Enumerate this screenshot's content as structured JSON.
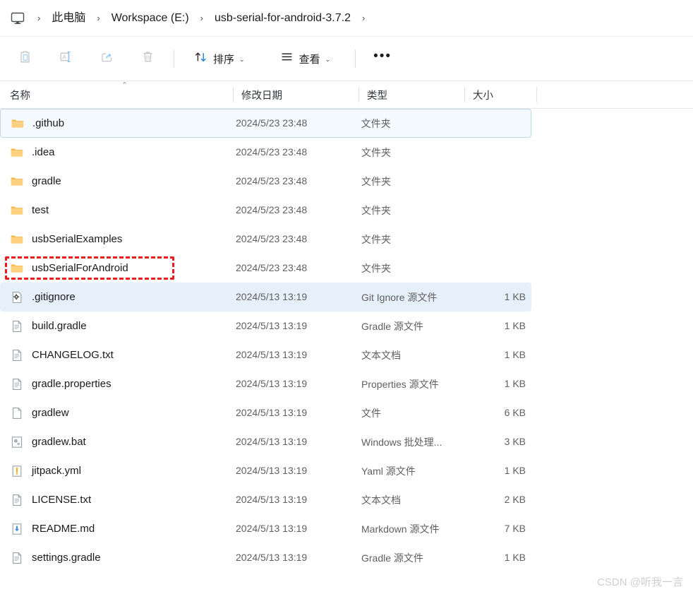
{
  "window": {
    "app": "File Explorer",
    "breadcrumb": {
      "home_icon": "monitor-icon",
      "items": [
        "此电脑",
        "Workspace (E:)",
        "usb-serial-for-android-3.7.2"
      ],
      "separator": "›",
      "trailing_separator": "›"
    }
  },
  "toolbar": {
    "icon_buttons": [
      {
        "name": "paste-button",
        "icon": "clipboard-paste-icon"
      },
      {
        "name": "rename-button",
        "icon": "rename-icon"
      },
      {
        "name": "share-button",
        "icon": "share-icon"
      },
      {
        "name": "delete-button",
        "icon": "trash-icon"
      }
    ],
    "sort_label": "排序",
    "sort_icon": "sort-arrows-icon",
    "view_label": "查看",
    "view_icon": "view-list-icon",
    "more_label": "•••",
    "caret": "⌄"
  },
  "columns": {
    "name": "名称",
    "date": "修改日期",
    "type": "类型",
    "size": "大小",
    "sort_indicator": "⌃"
  },
  "rows": [
    {
      "name": ".github",
      "date": "2024/5/23 23:48",
      "type": "文件夹",
      "size": "",
      "icon": "folder-icon",
      "state": "hovered"
    },
    {
      "name": ".idea",
      "date": "2024/5/23 23:48",
      "type": "文件夹",
      "size": "",
      "icon": "folder-icon",
      "state": "normal"
    },
    {
      "name": "gradle",
      "date": "2024/5/23 23:48",
      "type": "文件夹",
      "size": "",
      "icon": "folder-icon",
      "state": "normal"
    },
    {
      "name": "test",
      "date": "2024/5/23 23:48",
      "type": "文件夹",
      "size": "",
      "icon": "folder-icon",
      "state": "normal"
    },
    {
      "name": "usbSerialExamples",
      "date": "2024/5/23 23:48",
      "type": "文件夹",
      "size": "",
      "icon": "folder-icon",
      "state": "normal"
    },
    {
      "name": "usbSerialForAndroid",
      "date": "2024/5/23 23:48",
      "type": "文件夹",
      "size": "",
      "icon": "folder-icon",
      "state": "annotated"
    },
    {
      "name": ".gitignore",
      "date": "2024/5/13 13:19",
      "type": "Git Ignore 源文件",
      "size": "1 KB",
      "icon": "gear-file-icon",
      "state": "selected"
    },
    {
      "name": "build.gradle",
      "date": "2024/5/13 13:19",
      "type": "Gradle 源文件",
      "size": "1 KB",
      "icon": "text-file-icon",
      "state": "normal"
    },
    {
      "name": "CHANGELOG.txt",
      "date": "2024/5/13 13:19",
      "type": "文本文档",
      "size": "1 KB",
      "icon": "text-file-icon",
      "state": "normal"
    },
    {
      "name": "gradle.properties",
      "date": "2024/5/13 13:19",
      "type": "Properties 源文件",
      "size": "1 KB",
      "icon": "text-file-icon",
      "state": "normal"
    },
    {
      "name": "gradlew",
      "date": "2024/5/13 13:19",
      "type": "文件",
      "size": "6 KB",
      "icon": "blank-file-icon",
      "state": "normal"
    },
    {
      "name": "gradlew.bat",
      "date": "2024/5/13 13:19",
      "type": "Windows 批处理...",
      "size": "3 KB",
      "icon": "batch-file-icon",
      "state": "normal"
    },
    {
      "name": "jitpack.yml",
      "date": "2024/5/13 13:19",
      "type": "Yaml 源文件",
      "size": "1 KB",
      "icon": "yaml-file-icon",
      "state": "normal"
    },
    {
      "name": "LICENSE.txt",
      "date": "2024/5/13 13:19",
      "type": "文本文档",
      "size": "2 KB",
      "icon": "text-file-icon",
      "state": "normal"
    },
    {
      "name": "README.md",
      "date": "2024/5/13 13:19",
      "type": "Markdown 源文件",
      "size": "7 KB",
      "icon": "markdown-file-icon",
      "state": "normal"
    },
    {
      "name": "settings.gradle",
      "date": "2024/5/13 13:19",
      "type": "Gradle 源文件",
      "size": "1 KB",
      "icon": "text-file-icon",
      "state": "normal"
    }
  ],
  "annotation": {
    "color": "#ee1c1c",
    "target": "usbSerialForAndroid"
  },
  "watermark": "CSDN @听我一言",
  "colors": {
    "folder": "#fcc975",
    "selection": "#e5f0fb",
    "hover_border": "#bcd9f2",
    "accent": "#0a65c2"
  }
}
